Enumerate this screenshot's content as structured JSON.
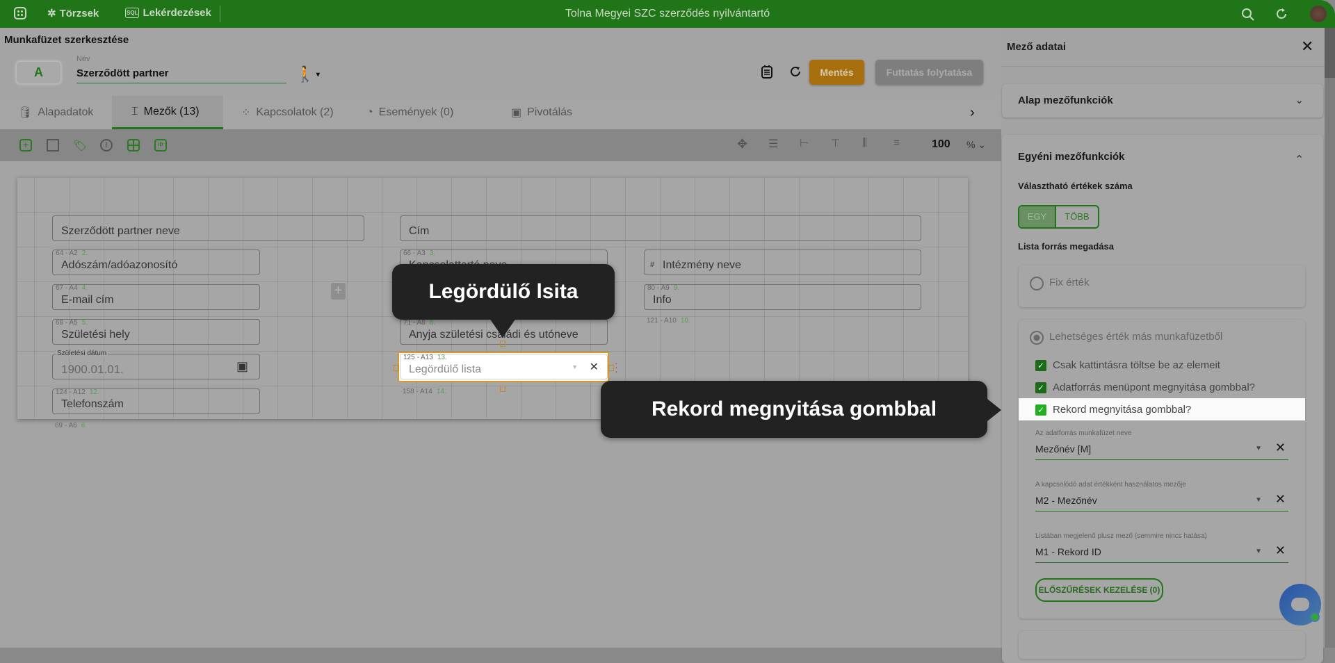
{
  "topbar": {
    "title": "Tolna Megyei SZC szerződés nyilvántartó",
    "nav": [
      {
        "label": "Törzsek",
        "icon": "hub-icon"
      },
      {
        "label": "Lekérdezések",
        "icon": "sql-icon"
      }
    ],
    "brand_color": "#207518"
  },
  "page": {
    "title": "Munkafüzet szerkesztése",
    "avatar_letter": "A",
    "name_label": "Név",
    "name_value": "Szerződött partner",
    "save_label": "Mentés",
    "run_label": "Futtatás folytatása",
    "save_color": "#a86f0e"
  },
  "tabs": [
    {
      "label": "Alapadatok",
      "icon": "database-icon"
    },
    {
      "label": "Mezők (13)",
      "icon": "field-icon",
      "active": true
    },
    {
      "label": "Kapcsolatok (2)",
      "icon": "relations-icon"
    },
    {
      "label": "Események (0)",
      "icon": "timer-icon"
    },
    {
      "label": "Pivotálás",
      "icon": "pivot-icon"
    }
  ],
  "toolbar": {
    "zoom": "100",
    "zoom_unit": "%"
  },
  "fields": [
    {
      "label": "",
      "value": "Szerződött partner neve"
    },
    {
      "label": "",
      "value": "Cím"
    },
    {
      "label": "64 - A2",
      "num": "2.",
      "value": "Adószám/adóazonosító"
    },
    {
      "label": "66 - A3",
      "num": "3.",
      "value": "Kapcsolattartó neve"
    },
    {
      "label": "",
      "prefix": "#",
      "value": "Intézmény neve"
    },
    {
      "label": "67 - A4",
      "num": "4.",
      "value": "E-mail cím"
    },
    {
      "label": "80 - A9",
      "num": "9.",
      "value": "Info"
    },
    {
      "label": "68 - A5",
      "num": "5.",
      "value": "Születési hely"
    },
    {
      "label": "71 - A8",
      "num": "8.",
      "value": "Anyja születési családi és utóneve"
    },
    {
      "label": "Születési dátum",
      "value": "1900.01.01."
    },
    {
      "label": "125 - A13",
      "num": "13.",
      "value": "Legördülő lista"
    },
    {
      "label": "124 - A12",
      "num": "12.",
      "value": "Telefonszám"
    }
  ],
  "loose_labels": [
    {
      "label": "121 - A10",
      "num": "10."
    },
    {
      "label": "158 - A14",
      "num": "14."
    },
    {
      "label": "69 - A6",
      "num": "6."
    }
  ],
  "tooltips": {
    "dropdown": "Legördülő lsita",
    "record": "Rekord megnyitása gombbal"
  },
  "panel": {
    "title": "Mező adatai",
    "basic_section": "Alap mezőfunkciók",
    "custom_section": "Egyéni mezőfunkciók",
    "choice_count_label": "Választható értékek száma",
    "choice_options": [
      {
        "label": "EGY",
        "selected": true
      },
      {
        "label": "TÖBB",
        "selected": false
      }
    ],
    "list_source_label": "Lista forrás megadása",
    "radio_fixed": "Fix érték",
    "radio_other": "Lehetséges érték más munkafüzetből",
    "checkboxes": [
      {
        "label": "Csak kattintásra töltse be az elemeit",
        "checked": true
      },
      {
        "label": "Adatforrás menüpont megnyitása gombbal?",
        "checked": true
      },
      {
        "label": "Rekord megnyitása gombbal?",
        "checked": true
      }
    ],
    "selects": [
      {
        "label": "Az adatforrás munkafüzet neve",
        "value": "Mezőnév [M]"
      },
      {
        "label": "A kapcsolódó adat értékként használatos mezője",
        "value": "M2 - Mezőnév"
      },
      {
        "label": "Listában megjelenő plusz mező (semmire nincs hatása)",
        "value": "M1 - Rekord ID"
      }
    ],
    "prefilter_button": "ELŐSZŰRÉSEK KEZELÉSE (0)"
  }
}
